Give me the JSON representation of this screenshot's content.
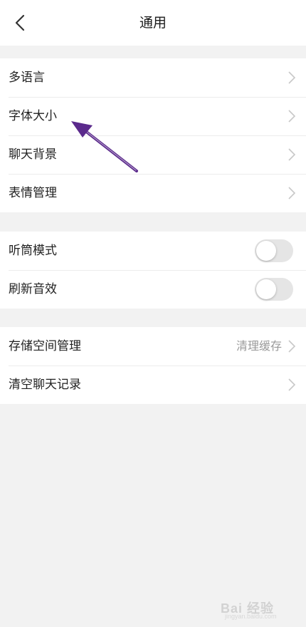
{
  "header": {
    "title": "通用"
  },
  "groups": {
    "general": {
      "items": [
        {
          "label": "多语言"
        },
        {
          "label": "字体大小"
        },
        {
          "label": "聊天背景"
        },
        {
          "label": "表情管理"
        }
      ]
    },
    "sound": {
      "items": [
        {
          "label": "听筒模式",
          "enabled": false
        },
        {
          "label": "刷新音效",
          "enabled": false
        }
      ]
    },
    "storage": {
      "items": [
        {
          "label": "存储空间管理",
          "value": "清理缓存"
        },
        {
          "label": "清空聊天记录"
        }
      ]
    }
  },
  "annotation": {
    "color": "#5b2a8c",
    "points_to": "字体大小"
  },
  "watermark": {
    "text": "Bai 经验",
    "sub": "jingyan.baidu.com"
  },
  "colors": {
    "background": "#f2f2f2",
    "toggle_off": "#e5e5e5",
    "chevron": "#c8c8c8",
    "secondary_text": "#9a9a9a"
  }
}
